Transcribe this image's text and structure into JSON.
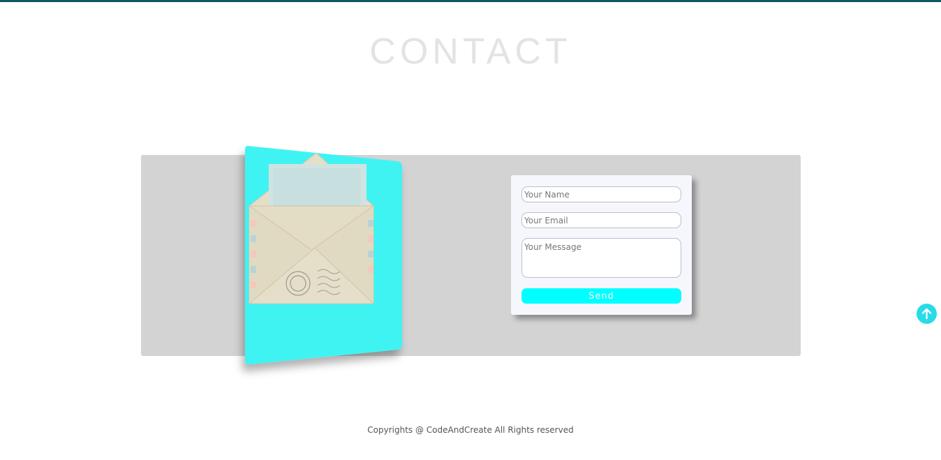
{
  "page": {
    "title": "CONTACT"
  },
  "form": {
    "name_placeholder": "Your Name",
    "email_placeholder": "Your Email",
    "message_placeholder": "Your Message",
    "send_label": "Send"
  },
  "footer": {
    "copyright": "Copyrights @ CodeAndCreate All Rights reserved"
  },
  "icons": {
    "scroll_top": "arrow-up-icon",
    "envelope": "envelope-icon"
  },
  "colors": {
    "accent": "#00ffff",
    "card": "#3ff3f3",
    "panel": "#d3d3d3",
    "top_bar": "#0b5a63",
    "title": "#e3e3e3",
    "scroll_button": "#27dbe8"
  }
}
